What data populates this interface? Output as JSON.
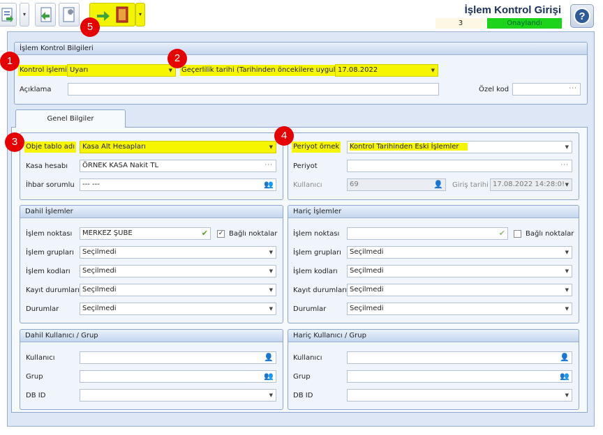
{
  "window": {
    "title": "İşlem Kontrol Girişi",
    "record_no": "3",
    "status": "Onaylandı"
  },
  "badges": [
    "1",
    "2",
    "3",
    "4",
    "5"
  ],
  "toolbar": {
    "icons": [
      "document-icon",
      "back-arrow-icon",
      "wrench-icon",
      "forward-door-icon"
    ],
    "dropdown_glyph": "▾"
  },
  "header_group": {
    "title": "İşlem Kontrol Bilgileri",
    "control_action_label": "Kontrol işlemi",
    "control_action_value": "Uyarı",
    "validity_label": "Geçerlilik tarihi (Tarihinden öncekilere uygula)",
    "validity_value": "17.08.2022",
    "description_label": "Açıklama",
    "description_value": "",
    "special_code_label": "Özel kod",
    "special_code_value": ""
  },
  "tab": {
    "label": "Genel Bilgiler"
  },
  "left_info": {
    "object_table_label": "Obje tablo adı",
    "object_table_value": "Kasa Alt Hesapları",
    "cash_account_label": "Kasa hesabı",
    "cash_account_value": "ÖRNEK KASA Nakit TL",
    "notice_owner_label": "İhbar sorumlu",
    "notice_owner_value": "--- ---"
  },
  "right_info": {
    "period_sample_label": "Periyot örnek",
    "period_sample_value": "Kontrol Tarihinden Eski İşlemler",
    "period_label": "Periyot",
    "period_value": "",
    "user_label": "Kullanıcı",
    "user_value": "69",
    "entry_date_label": "Giriş tarihi",
    "entry_date_value": "17.08.2022 14:28:0!"
  },
  "included_ops": {
    "title": "Dahil İşlemler",
    "point_label": "İşlem noktası",
    "point_value": "MERKEZ ŞUBE",
    "linked_label": "Bağlı noktalar",
    "linked_mark": "✓",
    "groups_label": "İşlem grupları",
    "groups_value": "Seçilmedi",
    "codes_label": "İşlem kodları",
    "codes_value": "Seçilmedi",
    "record_status_label": "Kayıt durumları",
    "record_status_value": "Seçilmedi",
    "states_label": "Durumlar",
    "states_value": "Seçilmedi"
  },
  "excluded_ops": {
    "title": "Hariç İşlemler",
    "point_label": "İşlem noktası",
    "point_value": "",
    "linked_label": "Bağlı noktalar",
    "groups_label": "İşlem grupları",
    "groups_value": "Seçilmedi",
    "codes_label": "İşlem kodları",
    "codes_value": "Seçilmedi",
    "record_status_label": "Kayıt durumları",
    "record_status_value": "Seçilmedi",
    "states_label": "Durumlar",
    "states_value": "Seçilmedi"
  },
  "included_users": {
    "title": "Dahil Kullanıcı / Grup",
    "user_label": "Kullanıcı",
    "group_label": "Grup",
    "dbid_label": "DB ID"
  },
  "excluded_users": {
    "title": "Hariç Kullanıcı / Grup",
    "user_label": "Kullanıcı",
    "group_label": "Grup",
    "dbid_label": "DB ID"
  },
  "colors": {
    "highlight": "#f6f600",
    "status_green": "#1bd41b",
    "badge_red": "#e60000",
    "panel_border": "#8ba6cf"
  }
}
